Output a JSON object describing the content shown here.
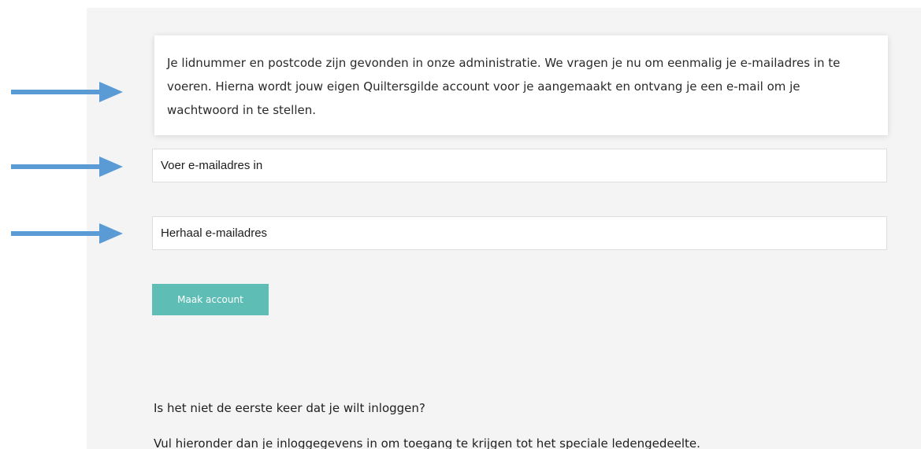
{
  "info": {
    "message": "Je lidnummer en postcode zijn gevonden in onze administratie. We vragen je nu om eenmalig je e-mailadres in te voeren. Hierna wordt jouw eigen Quiltersgilde account voor je aangemaakt en ontvang je een e-mail om je wachtwoord in te stellen."
  },
  "form": {
    "email_placeholder": "Voer e-mailadres in",
    "email_repeat_placeholder": "Herhaal e-mailadres",
    "submit_label": "Maak account"
  },
  "login": {
    "question": "Is het niet de eerste keer dat je wilt inloggen?",
    "instruction": "Vul hieronder dan je inloggegevens in om toegang te krijgen tot het speciale ledengedeelte."
  },
  "colors": {
    "arrow": "#5b9bd5",
    "button": "#5ebdb4",
    "panel": "#f4f4f4"
  },
  "icons": {
    "arrow": "arrow-right-icon"
  }
}
